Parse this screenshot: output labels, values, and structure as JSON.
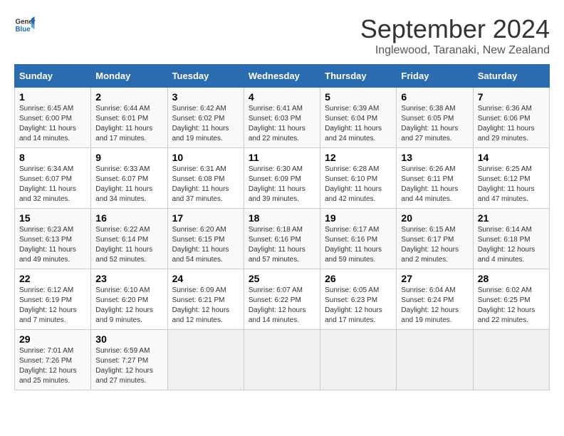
{
  "logo": {
    "line1": "General",
    "line2": "Blue"
  },
  "title": "September 2024",
  "location": "Inglewood, Taranaki, New Zealand",
  "columns": [
    "Sunday",
    "Monday",
    "Tuesday",
    "Wednesday",
    "Thursday",
    "Friday",
    "Saturday"
  ],
  "weeks": [
    [
      {
        "day": "1",
        "info": "Sunrise: 6:45 AM\nSunset: 6:00 PM\nDaylight: 11 hours\nand 14 minutes."
      },
      {
        "day": "2",
        "info": "Sunrise: 6:44 AM\nSunset: 6:01 PM\nDaylight: 11 hours\nand 17 minutes."
      },
      {
        "day": "3",
        "info": "Sunrise: 6:42 AM\nSunset: 6:02 PM\nDaylight: 11 hours\nand 19 minutes."
      },
      {
        "day": "4",
        "info": "Sunrise: 6:41 AM\nSunset: 6:03 PM\nDaylight: 11 hours\nand 22 minutes."
      },
      {
        "day": "5",
        "info": "Sunrise: 6:39 AM\nSunset: 6:04 PM\nDaylight: 11 hours\nand 24 minutes."
      },
      {
        "day": "6",
        "info": "Sunrise: 6:38 AM\nSunset: 6:05 PM\nDaylight: 11 hours\nand 27 minutes."
      },
      {
        "day": "7",
        "info": "Sunrise: 6:36 AM\nSunset: 6:06 PM\nDaylight: 11 hours\nand 29 minutes."
      }
    ],
    [
      {
        "day": "8",
        "info": "Sunrise: 6:34 AM\nSunset: 6:07 PM\nDaylight: 11 hours\nand 32 minutes."
      },
      {
        "day": "9",
        "info": "Sunrise: 6:33 AM\nSunset: 6:07 PM\nDaylight: 11 hours\nand 34 minutes."
      },
      {
        "day": "10",
        "info": "Sunrise: 6:31 AM\nSunset: 6:08 PM\nDaylight: 11 hours\nand 37 minutes."
      },
      {
        "day": "11",
        "info": "Sunrise: 6:30 AM\nSunset: 6:09 PM\nDaylight: 11 hours\nand 39 minutes."
      },
      {
        "day": "12",
        "info": "Sunrise: 6:28 AM\nSunset: 6:10 PM\nDaylight: 11 hours\nand 42 minutes."
      },
      {
        "day": "13",
        "info": "Sunrise: 6:26 AM\nSunset: 6:11 PM\nDaylight: 11 hours\nand 44 minutes."
      },
      {
        "day": "14",
        "info": "Sunrise: 6:25 AM\nSunset: 6:12 PM\nDaylight: 11 hours\nand 47 minutes."
      }
    ],
    [
      {
        "day": "15",
        "info": "Sunrise: 6:23 AM\nSunset: 6:13 PM\nDaylight: 11 hours\nand 49 minutes."
      },
      {
        "day": "16",
        "info": "Sunrise: 6:22 AM\nSunset: 6:14 PM\nDaylight: 11 hours\nand 52 minutes."
      },
      {
        "day": "17",
        "info": "Sunrise: 6:20 AM\nSunset: 6:15 PM\nDaylight: 11 hours\nand 54 minutes."
      },
      {
        "day": "18",
        "info": "Sunrise: 6:18 AM\nSunset: 6:16 PM\nDaylight: 11 hours\nand 57 minutes."
      },
      {
        "day": "19",
        "info": "Sunrise: 6:17 AM\nSunset: 6:16 PM\nDaylight: 11 hours\nand 59 minutes."
      },
      {
        "day": "20",
        "info": "Sunrise: 6:15 AM\nSunset: 6:17 PM\nDaylight: 12 hours\nand 2 minutes."
      },
      {
        "day": "21",
        "info": "Sunrise: 6:14 AM\nSunset: 6:18 PM\nDaylight: 12 hours\nand 4 minutes."
      }
    ],
    [
      {
        "day": "22",
        "info": "Sunrise: 6:12 AM\nSunset: 6:19 PM\nDaylight: 12 hours\nand 7 minutes."
      },
      {
        "day": "23",
        "info": "Sunrise: 6:10 AM\nSunset: 6:20 PM\nDaylight: 12 hours\nand 9 minutes."
      },
      {
        "day": "24",
        "info": "Sunrise: 6:09 AM\nSunset: 6:21 PM\nDaylight: 12 hours\nand 12 minutes."
      },
      {
        "day": "25",
        "info": "Sunrise: 6:07 AM\nSunset: 6:22 PM\nDaylight: 12 hours\nand 14 minutes."
      },
      {
        "day": "26",
        "info": "Sunrise: 6:05 AM\nSunset: 6:23 PM\nDaylight: 12 hours\nand 17 minutes."
      },
      {
        "day": "27",
        "info": "Sunrise: 6:04 AM\nSunset: 6:24 PM\nDaylight: 12 hours\nand 19 minutes."
      },
      {
        "day": "28",
        "info": "Sunrise: 6:02 AM\nSunset: 6:25 PM\nDaylight: 12 hours\nand 22 minutes."
      }
    ],
    [
      {
        "day": "29",
        "info": "Sunrise: 7:01 AM\nSunset: 7:26 PM\nDaylight: 12 hours\nand 25 minutes."
      },
      {
        "day": "30",
        "info": "Sunrise: 6:59 AM\nSunset: 7:27 PM\nDaylight: 12 hours\nand 27 minutes."
      },
      null,
      null,
      null,
      null,
      null
    ]
  ]
}
